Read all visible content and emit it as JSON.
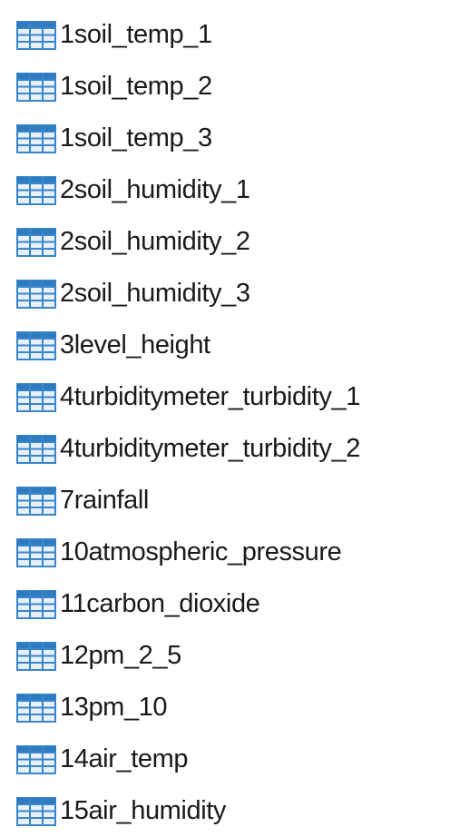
{
  "icon": "table-grid-icon",
  "colors": {
    "icon_header": "#2e7bc0",
    "icon_grid": "#3a86cc",
    "icon_cell": "#e8f1fb",
    "text": "#1a1a1a"
  },
  "tables": [
    {
      "label": "1soil_temp_1"
    },
    {
      "label": "1soil_temp_2"
    },
    {
      "label": "1soil_temp_3"
    },
    {
      "label": "2soil_humidity_1"
    },
    {
      "label": "2soil_humidity_2"
    },
    {
      "label": "2soil_humidity_3"
    },
    {
      "label": "3level_height"
    },
    {
      "label": "4turbiditymeter_turbidity_1"
    },
    {
      "label": "4turbiditymeter_turbidity_2"
    },
    {
      "label": "7rainfall"
    },
    {
      "label": "10atmospheric_pressure"
    },
    {
      "label": "11carbon_dioxide"
    },
    {
      "label": "12pm_2_5"
    },
    {
      "label": "13pm_10"
    },
    {
      "label": "14air_temp"
    },
    {
      "label": "15air_humidity"
    }
  ]
}
